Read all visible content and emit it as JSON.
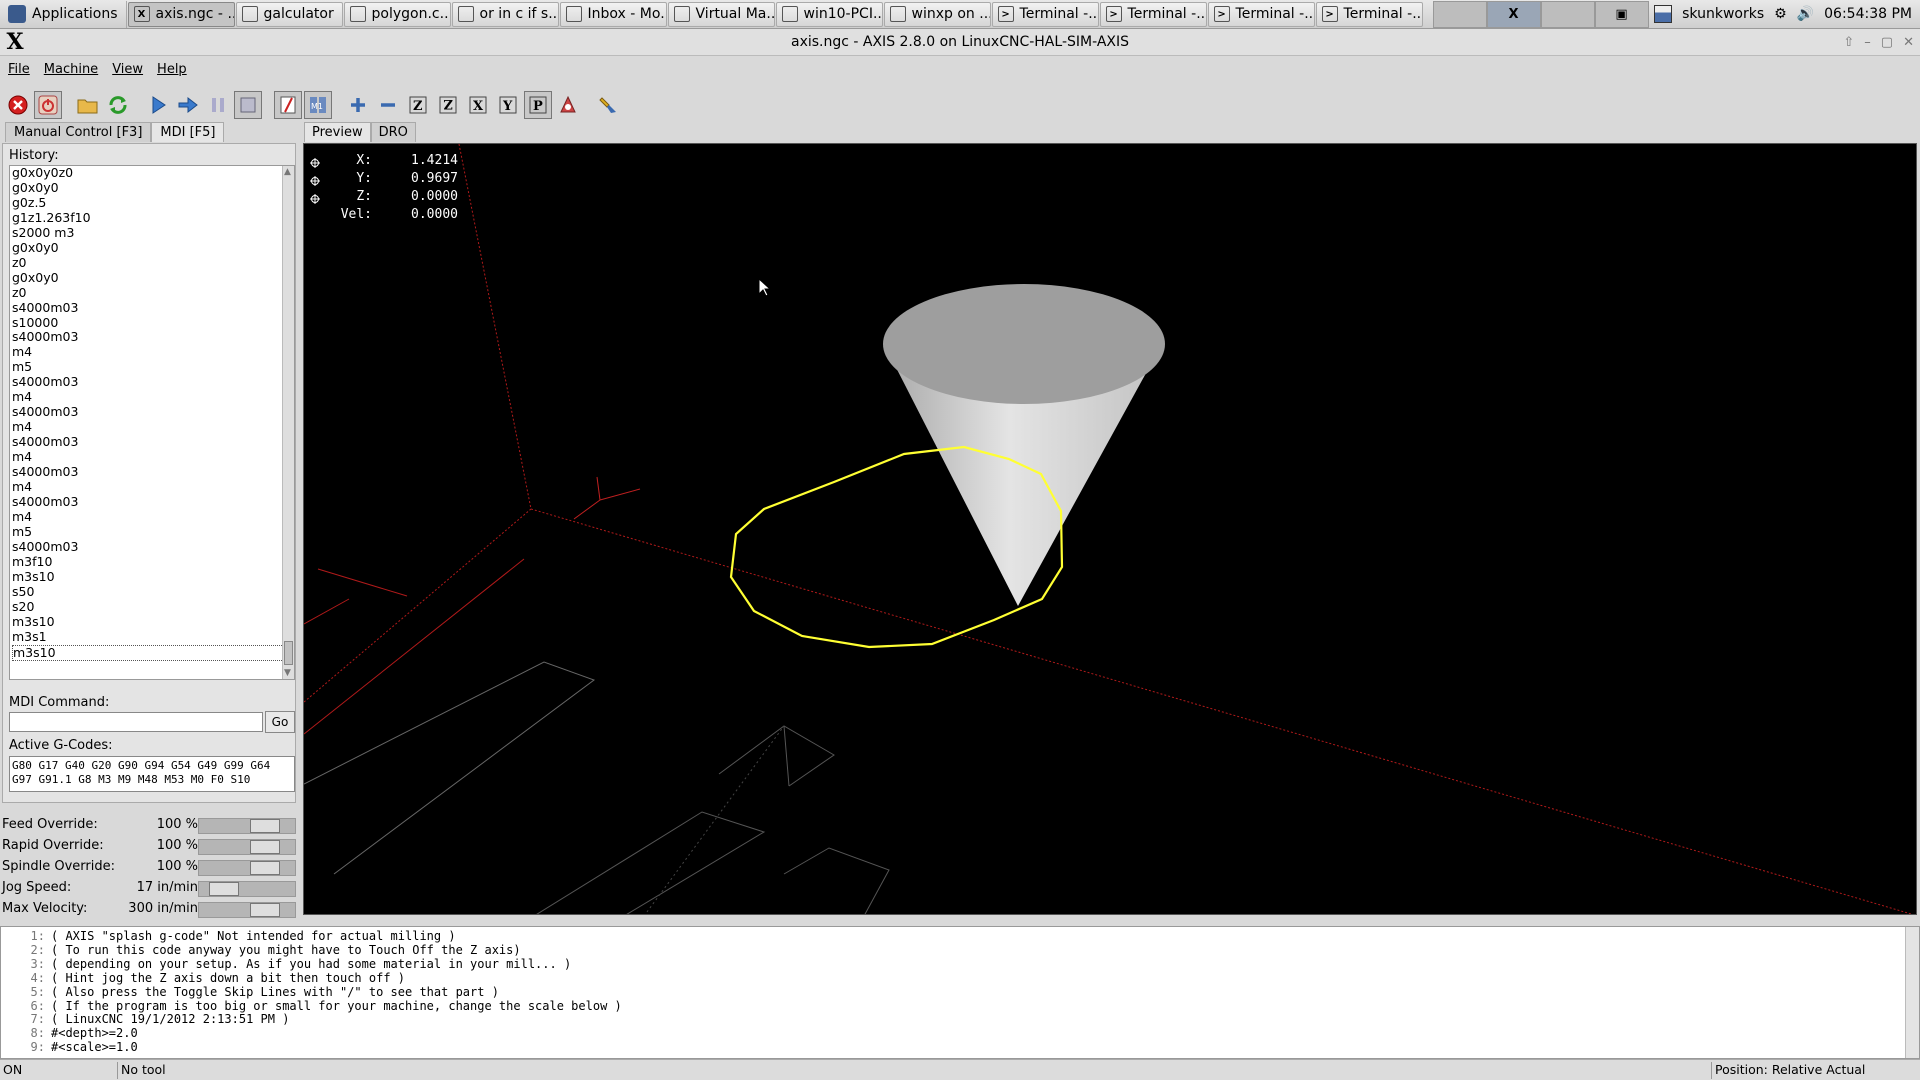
{
  "taskbar": {
    "applications_label": "Applications",
    "tasks": [
      {
        "label": "axis.ngc - ...",
        "icon": "X",
        "active": true
      },
      {
        "label": "galculator",
        "icon": "calc",
        "active": false
      },
      {
        "label": "polygon.c...",
        "icon": "edit",
        "active": false
      },
      {
        "label": "or in c if s...",
        "icon": "chrome",
        "active": false
      },
      {
        "label": "Inbox - Mo...",
        "icon": "mail",
        "active": false
      },
      {
        "label": "Virtual Ma...",
        "icon": "vm",
        "active": false
      },
      {
        "label": "win10-PCI...",
        "icon": "vm",
        "active": false
      },
      {
        "label": "winxp on ...",
        "icon": "vm",
        "active": false
      },
      {
        "label": "Terminal -...",
        "icon": "terminal",
        "active": false
      },
      {
        "label": "Terminal -...",
        "icon": "terminal",
        "active": false
      },
      {
        "label": "Terminal -...",
        "icon": "terminal",
        "active": false
      },
      {
        "label": "Terminal -...",
        "icon": "terminal",
        "active": false
      }
    ],
    "user": "skunkworks",
    "clock": "06:54:38 PM"
  },
  "window": {
    "title": "axis.ngc - AXIS 2.8.0 on LinuxCNC-HAL-SIM-AXIS"
  },
  "menu": [
    "File",
    "Machine",
    "View",
    "Help"
  ],
  "left_tabs": [
    {
      "label": "Manual Control [F3]",
      "active": false
    },
    {
      "label": "MDI [F5]",
      "active": true
    }
  ],
  "mdi": {
    "history_label": "History:",
    "history": [
      "g0x0y0z0",
      "g0x0y0",
      "g0z.5",
      "g1z1.263f10",
      "s2000 m3",
      "g0x0y0",
      "z0",
      "g0x0y0",
      "z0",
      "s4000m03",
      "s10000",
      "s4000m03",
      "m4",
      "m5",
      "s4000m03",
      "m4",
      "s4000m03",
      "m4",
      "s4000m03",
      "m4",
      "s4000m03",
      "m4",
      "s4000m03",
      "m4",
      "m5",
      "s4000m03",
      "m3f10",
      "m3s10",
      "s50",
      "s20",
      "m3s10",
      "m3s1",
      "m3s10"
    ],
    "command_label": "MDI Command:",
    "command_value": "",
    "go_label": "Go",
    "active_label": "Active G-Codes:",
    "active_line1": "G80 G17 G40 G20 G90 G94 G54 G49 G99 G64",
    "active_line2": "G97 G91.1 G8 M3 M9 M48 M53 M0 F0 S10"
  },
  "overrides": [
    {
      "name": "Feed Override:",
      "value": "100 %",
      "fraction": 0.75
    },
    {
      "name": "Rapid Override:",
      "value": "100 %",
      "fraction": 0.75
    },
    {
      "name": "Spindle Override:",
      "value": "100 %",
      "fraction": 0.75
    },
    {
      "name": "Jog Speed:",
      "value": "17 in/min",
      "fraction": 0.15
    },
    {
      "name": "Max Velocity:",
      "value": "300 in/min",
      "fraction": 0.75
    }
  ],
  "preview_tabs": [
    {
      "label": "Preview",
      "active": true
    },
    {
      "label": "DRO",
      "active": false
    }
  ],
  "dro": [
    {
      "axis": "X:",
      "value": "1.4214"
    },
    {
      "axis": "Y:",
      "value": "0.9697"
    },
    {
      "axis": "Z:",
      "value": "0.0000"
    },
    {
      "axis": "Vel:",
      "value": "0.0000"
    }
  ],
  "gcode": [
    {
      "n": "1:",
      "text": "( AXIS \"splash g-code\" Not intended for actual milling )"
    },
    {
      "n": "2:",
      "text": "( To run this code anyway you might have to Touch Off the Z axis)"
    },
    {
      "n": "3:",
      "text": "( depending on your setup. As if you had some material in your mill... )"
    },
    {
      "n": "4:",
      "text": "( Hint jog the Z axis down a bit then touch off )"
    },
    {
      "n": "5:",
      "text": "( Also press the Toggle Skip Lines with \"/\" to see that part )"
    },
    {
      "n": "6:",
      "text": "( If the program is too big or small for your machine, change the scale below )"
    },
    {
      "n": "7:",
      "text": "( LinuxCNC 19/1/2012 2:13:51 PM )"
    },
    {
      "n": "8:",
      "text": "#<depth>=2.0"
    },
    {
      "n": "9:",
      "text": "#<scale>=1.0"
    }
  ],
  "status": {
    "state": "ON",
    "tool": "No tool",
    "position": "Position: Relative Actual"
  },
  "colors": {
    "toolpath": "#ffff33",
    "limits": "#c01818",
    "cone": "#d8d8d8",
    "viewport_bg": "#000000"
  }
}
